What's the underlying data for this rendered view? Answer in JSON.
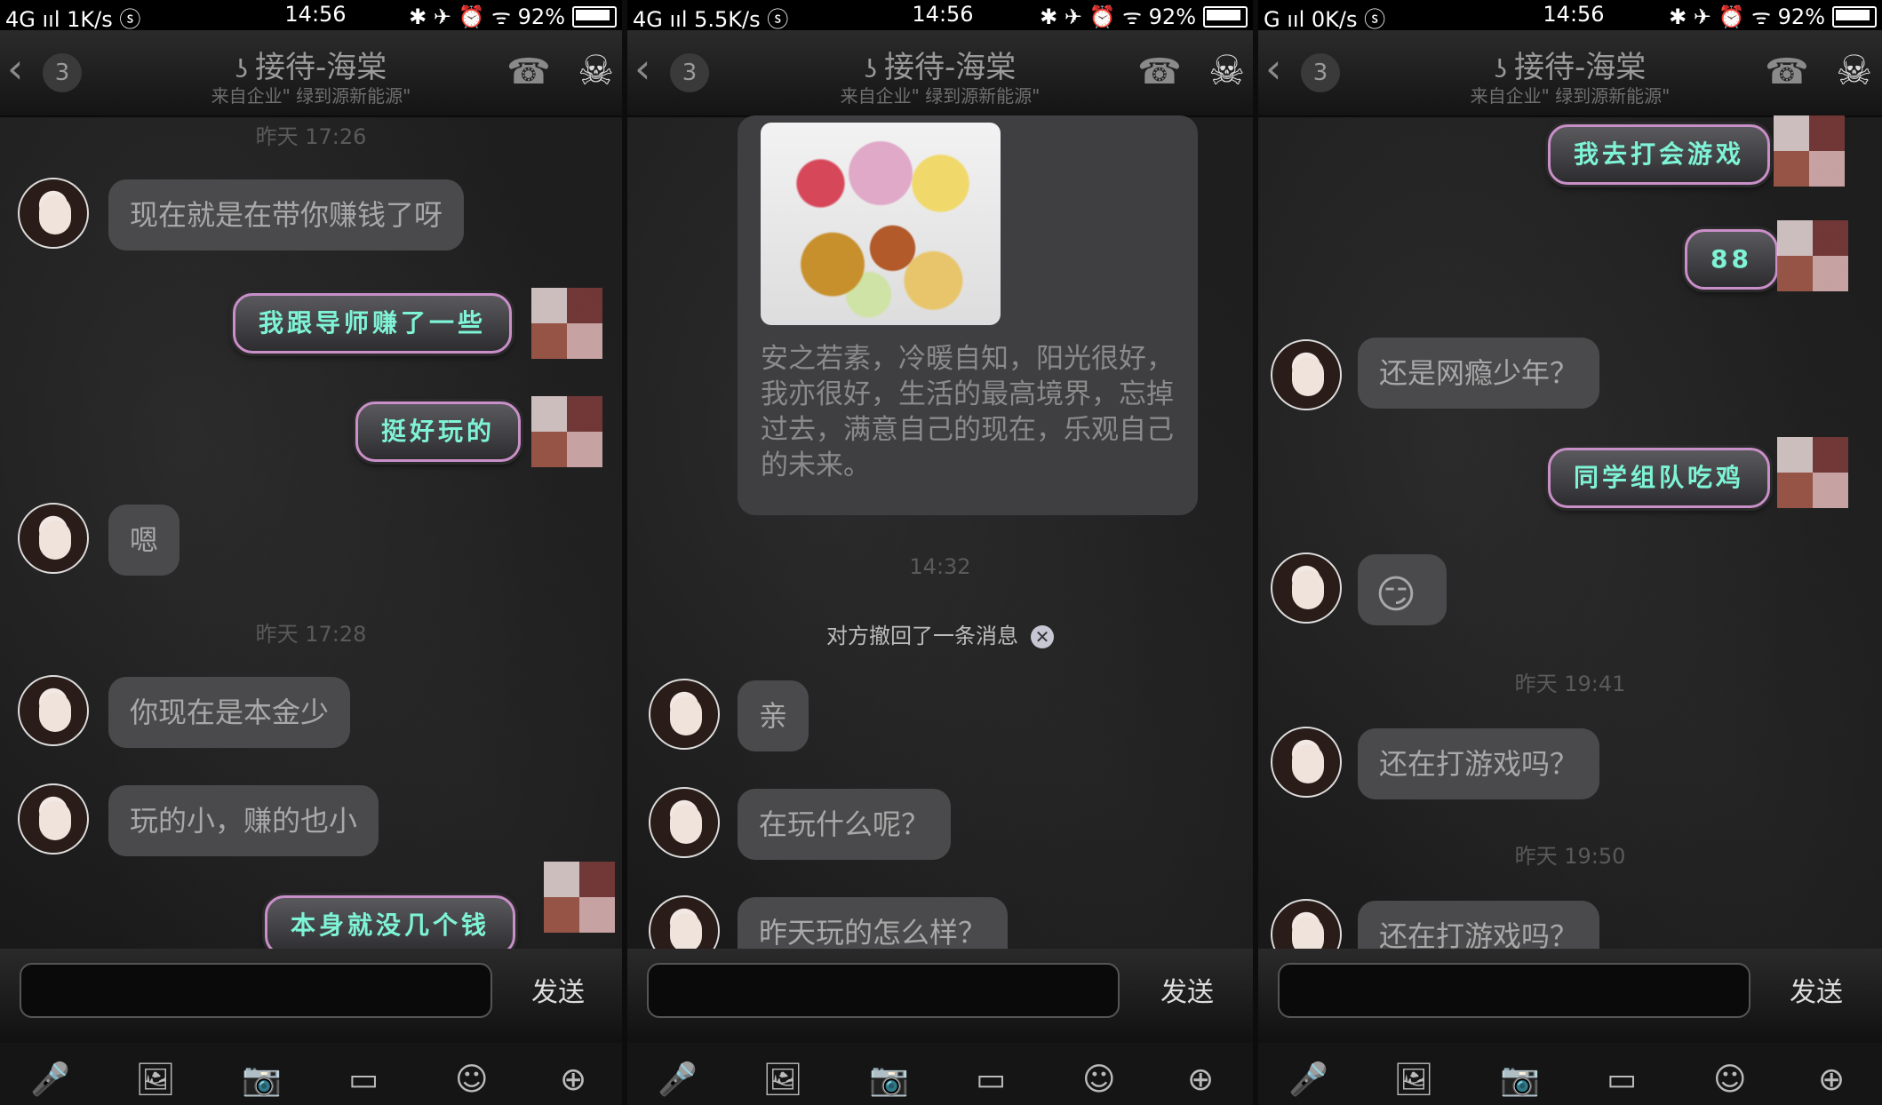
{
  "panels": [
    {
      "status": {
        "left": "4G ııl  1K/s ⓢ",
        "time": "14:56",
        "right": "✱ ✈ ⏰ ᯤ 92%"
      },
      "header": {
        "back": "‹",
        "count": "3",
        "title": "接待-海棠",
        "subtitle": "来自企业\" 绿到源新能源\""
      },
      "messages": {
        "ts1": "昨天 17:26",
        "r1": "现在就是在带你赚钱了呀",
        "s1": "我跟导师赚了一些",
        "s2": "挺好玩的",
        "r2": "嗯",
        "ts2": "昨天 17:28",
        "r3": "你现在是本金少",
        "r4": "玩的小，赚的也小",
        "s3": "本身就没几个钱"
      },
      "send": "发送"
    },
    {
      "status": {
        "left": "4G ııl  5.5K/s ⓢ",
        "time": "14:56",
        "right": "✱ ✈ ⏰ ᯤ 92%"
      },
      "header": {
        "back": "‹",
        "count": "3",
        "title": "接待-海棠",
        "subtitle": "来自企业\" 绿到源新能源\""
      },
      "messages": {
        "card_text": "安之若素，冷暖自知，阳光很好，我亦很好，生活的最高境界，忘掉过去，满意自己的现在，乐观自己的未来。",
        "ts1": "14:32",
        "recall": "对方撤回了一条消息",
        "r1": "亲",
        "r2": "在玩什么呢？",
        "r3": "昨天玩的怎么样？"
      },
      "send": "发送"
    },
    {
      "status": {
        "left": "G ııl  0K/s ⓢ",
        "time": "14:56",
        "right": "✱ ✈ ⏰ ᯤ 92%"
      },
      "header": {
        "back": "‹",
        "count": "3",
        "title": "接待-海棠",
        "subtitle": "来自企业\" 绿到源新能源\""
      },
      "messages": {
        "s1": "我去打会游戏",
        "s2": "88",
        "r1": "还是网瘾少年？",
        "s3": "同学组队吃鸡",
        "r2_emoji": "😏",
        "ts1": "昨天 19:41",
        "r3": "还在打游戏吗？",
        "ts2": "昨天 19:50",
        "r4": "还在打游戏吗？"
      },
      "send": "发送"
    }
  ],
  "icons": {
    "phone": "☎",
    "skull": "☠",
    "ear": "ʖ",
    "mic": "🎤",
    "image": "🖼",
    "camera": "📷",
    "card": "▭",
    "smile": "☺",
    "plus": "⊕"
  }
}
